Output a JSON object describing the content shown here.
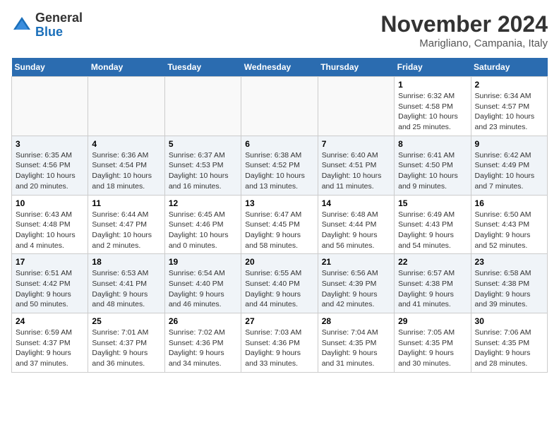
{
  "header": {
    "logo_line1": "General",
    "logo_line2": "Blue",
    "month": "November 2024",
    "location": "Marigliano, Campania, Italy"
  },
  "weekdays": [
    "Sunday",
    "Monday",
    "Tuesday",
    "Wednesday",
    "Thursday",
    "Friday",
    "Saturday"
  ],
  "weeks": [
    [
      {
        "day": "",
        "info": ""
      },
      {
        "day": "",
        "info": ""
      },
      {
        "day": "",
        "info": ""
      },
      {
        "day": "",
        "info": ""
      },
      {
        "day": "",
        "info": ""
      },
      {
        "day": "1",
        "info": "Sunrise: 6:32 AM\nSunset: 4:58 PM\nDaylight: 10 hours and 25 minutes."
      },
      {
        "day": "2",
        "info": "Sunrise: 6:34 AM\nSunset: 4:57 PM\nDaylight: 10 hours and 23 minutes."
      }
    ],
    [
      {
        "day": "3",
        "info": "Sunrise: 6:35 AM\nSunset: 4:56 PM\nDaylight: 10 hours and 20 minutes."
      },
      {
        "day": "4",
        "info": "Sunrise: 6:36 AM\nSunset: 4:54 PM\nDaylight: 10 hours and 18 minutes."
      },
      {
        "day": "5",
        "info": "Sunrise: 6:37 AM\nSunset: 4:53 PM\nDaylight: 10 hours and 16 minutes."
      },
      {
        "day": "6",
        "info": "Sunrise: 6:38 AM\nSunset: 4:52 PM\nDaylight: 10 hours and 13 minutes."
      },
      {
        "day": "7",
        "info": "Sunrise: 6:40 AM\nSunset: 4:51 PM\nDaylight: 10 hours and 11 minutes."
      },
      {
        "day": "8",
        "info": "Sunrise: 6:41 AM\nSunset: 4:50 PM\nDaylight: 10 hours and 9 minutes."
      },
      {
        "day": "9",
        "info": "Sunrise: 6:42 AM\nSunset: 4:49 PM\nDaylight: 10 hours and 7 minutes."
      }
    ],
    [
      {
        "day": "10",
        "info": "Sunrise: 6:43 AM\nSunset: 4:48 PM\nDaylight: 10 hours and 4 minutes."
      },
      {
        "day": "11",
        "info": "Sunrise: 6:44 AM\nSunset: 4:47 PM\nDaylight: 10 hours and 2 minutes."
      },
      {
        "day": "12",
        "info": "Sunrise: 6:45 AM\nSunset: 4:46 PM\nDaylight: 10 hours and 0 minutes."
      },
      {
        "day": "13",
        "info": "Sunrise: 6:47 AM\nSunset: 4:45 PM\nDaylight: 9 hours and 58 minutes."
      },
      {
        "day": "14",
        "info": "Sunrise: 6:48 AM\nSunset: 4:44 PM\nDaylight: 9 hours and 56 minutes."
      },
      {
        "day": "15",
        "info": "Sunrise: 6:49 AM\nSunset: 4:43 PM\nDaylight: 9 hours and 54 minutes."
      },
      {
        "day": "16",
        "info": "Sunrise: 6:50 AM\nSunset: 4:43 PM\nDaylight: 9 hours and 52 minutes."
      }
    ],
    [
      {
        "day": "17",
        "info": "Sunrise: 6:51 AM\nSunset: 4:42 PM\nDaylight: 9 hours and 50 minutes."
      },
      {
        "day": "18",
        "info": "Sunrise: 6:53 AM\nSunset: 4:41 PM\nDaylight: 9 hours and 48 minutes."
      },
      {
        "day": "19",
        "info": "Sunrise: 6:54 AM\nSunset: 4:40 PM\nDaylight: 9 hours and 46 minutes."
      },
      {
        "day": "20",
        "info": "Sunrise: 6:55 AM\nSunset: 4:40 PM\nDaylight: 9 hours and 44 minutes."
      },
      {
        "day": "21",
        "info": "Sunrise: 6:56 AM\nSunset: 4:39 PM\nDaylight: 9 hours and 42 minutes."
      },
      {
        "day": "22",
        "info": "Sunrise: 6:57 AM\nSunset: 4:38 PM\nDaylight: 9 hours and 41 minutes."
      },
      {
        "day": "23",
        "info": "Sunrise: 6:58 AM\nSunset: 4:38 PM\nDaylight: 9 hours and 39 minutes."
      }
    ],
    [
      {
        "day": "24",
        "info": "Sunrise: 6:59 AM\nSunset: 4:37 PM\nDaylight: 9 hours and 37 minutes."
      },
      {
        "day": "25",
        "info": "Sunrise: 7:01 AM\nSunset: 4:37 PM\nDaylight: 9 hours and 36 minutes."
      },
      {
        "day": "26",
        "info": "Sunrise: 7:02 AM\nSunset: 4:36 PM\nDaylight: 9 hours and 34 minutes."
      },
      {
        "day": "27",
        "info": "Sunrise: 7:03 AM\nSunset: 4:36 PM\nDaylight: 9 hours and 33 minutes."
      },
      {
        "day": "28",
        "info": "Sunrise: 7:04 AM\nSunset: 4:35 PM\nDaylight: 9 hours and 31 minutes."
      },
      {
        "day": "29",
        "info": "Sunrise: 7:05 AM\nSunset: 4:35 PM\nDaylight: 9 hours and 30 minutes."
      },
      {
        "day": "30",
        "info": "Sunrise: 7:06 AM\nSunset: 4:35 PM\nDaylight: 9 hours and 28 minutes."
      }
    ]
  ]
}
